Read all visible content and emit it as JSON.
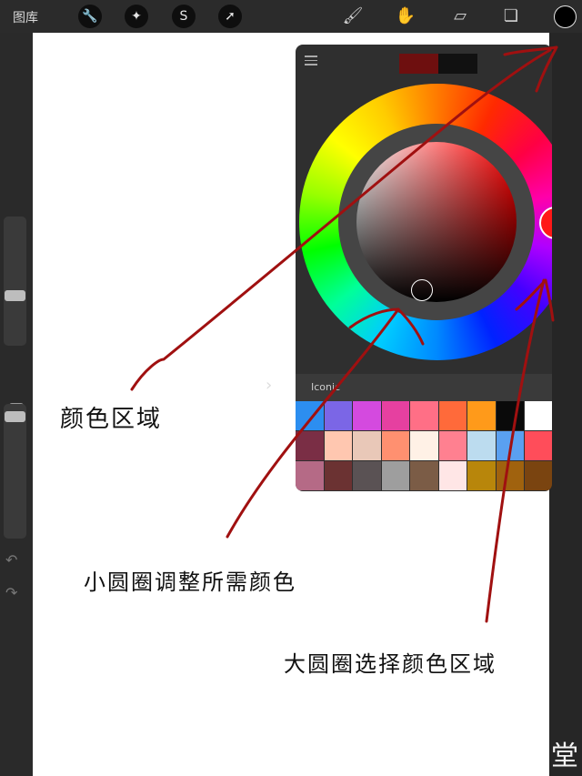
{
  "topbar": {
    "gallery_label": "图库",
    "tools": [
      {
        "icon": "wrench-icon",
        "glyph": "🔧"
      },
      {
        "icon": "magic-wand-icon",
        "glyph": "✦"
      },
      {
        "icon": "selection-s-icon",
        "glyph": "S"
      },
      {
        "icon": "transform-arrow-icon",
        "glyph": "➚"
      }
    ],
    "right_tools": [
      {
        "icon": "brush-icon",
        "glyph": "🖌"
      },
      {
        "icon": "smudge-icon",
        "glyph": "✋"
      },
      {
        "icon": "eraser-icon",
        "glyph": "▱"
      },
      {
        "icon": "layers-icon",
        "glyph": "❏"
      }
    ],
    "current_color": "#000000"
  },
  "color_panel": {
    "current_swatch": "#6e0f0f",
    "previous_swatch": "#111111",
    "palette_name": "Iconic",
    "palette_arrow": "›",
    "palette": [
      "#2c8ef0",
      "#7b66e6",
      "#d44adf",
      "#e640a0",
      "#ff6f86",
      "#ff6a3a",
      "#ff9a1a",
      "#0a0a0a",
      "#ffffff",
      "#b7a193",
      "#7a2e45",
      "#ffc7b0",
      "#e9c8b8",
      "#ff9070",
      "#fff1e6",
      "#ff8090",
      "#bcdcef",
      "#5aa0f0",
      "#ff4d5a",
      "#2f2f2f",
      "#b56a86",
      "#6b3232",
      "#5a5254",
      "#9e9e9e",
      "#7b5c46",
      "#ffe6e6",
      "#b8860b",
      "#a0620e",
      "#7a4410",
      "#2f2f2f"
    ]
  },
  "annotations": {
    "color_area": "颜色区域",
    "small_circle": "小圆圈调整所需颜色",
    "big_circle": "大圆圈选择颜色区域",
    "ink_color": "#a01010"
  },
  "watermark": "堂"
}
